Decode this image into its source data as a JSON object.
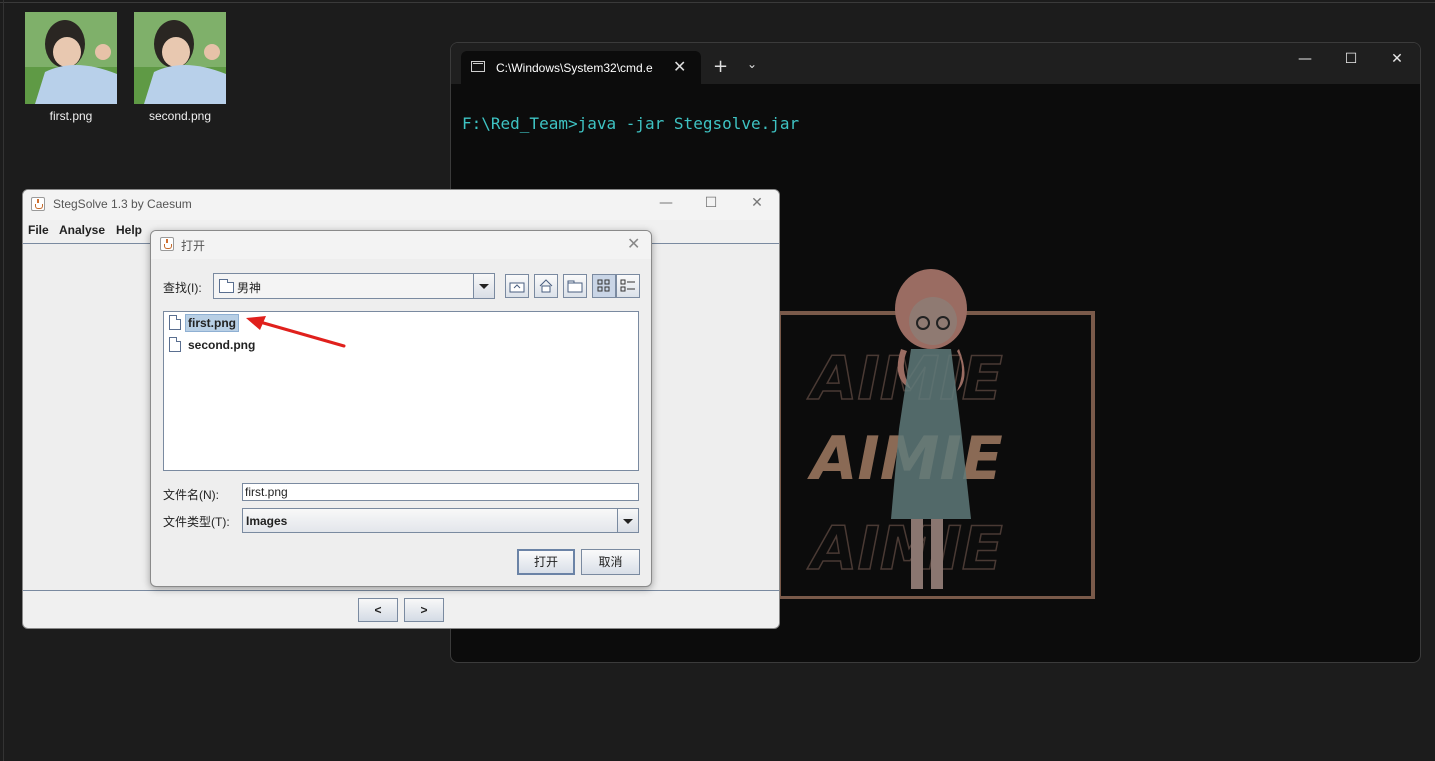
{
  "desktop": {
    "icons": [
      {
        "label": "first.png"
      },
      {
        "label": "second.png"
      }
    ]
  },
  "terminal": {
    "tab_title": "C:\\Windows\\System32\\cmd.e",
    "prompt_line": "F:\\Red_Team>java -jar Stegsolve.jar",
    "art_text": "AIMIE",
    "colors": {
      "prompt": "#3ec3c3",
      "background": "#0c0c0c"
    }
  },
  "stegsolve": {
    "title": "StegSolve 1.3 by Caesum",
    "menu": [
      "File",
      "Analyse",
      "Help"
    ],
    "prev_label": "<",
    "next_label": ">"
  },
  "open_dialog": {
    "title": "打开",
    "look_in_label": "查找(I):",
    "look_in_value": "男神",
    "files": [
      {
        "name": "first.png",
        "selected": true
      },
      {
        "name": "second.png",
        "selected": false
      }
    ],
    "filename_label": "文件名(N):",
    "filename_value": "first.png",
    "filetype_label": "文件类型(T):",
    "filetype_value": "Images",
    "open_button": "打开",
    "cancel_button": "取消",
    "toolbar_icons": [
      "up-folder-icon",
      "home-icon",
      "new-folder-icon",
      "list-view-icon",
      "details-view-icon"
    ]
  },
  "annotation": {
    "color": "#e0201c"
  }
}
